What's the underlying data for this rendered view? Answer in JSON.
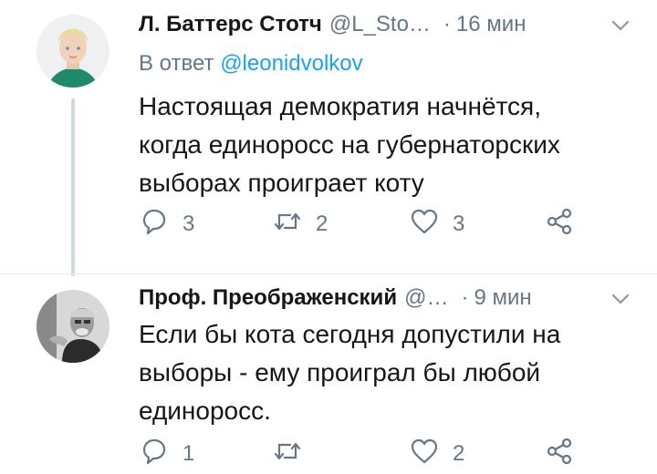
{
  "tweets": [
    {
      "author_name": "Л. Баттерс Стотч",
      "handle": "@L_Sto…",
      "dot": "·",
      "time": "16 мин",
      "reply_prefix": "В ответ",
      "reply_mention": "@leonidvolkov",
      "text_lines": [
        "Настоящая демократия начнётся,",
        "когда единоросс на губернаторских",
        "выборах проиграет коту"
      ],
      "counts": {
        "replies": "3",
        "retweets": "2",
        "likes": "3"
      }
    },
    {
      "author_name": "Проф. Преображенский",
      "handle": "@…",
      "dot": "·",
      "time": "9 мин",
      "text_lines": [
        "Если бы кота сегодня допустили на",
        "выборы - ему проиграл бы любой",
        "единоросс."
      ],
      "counts": {
        "replies": "1",
        "retweets": "",
        "likes": "2"
      }
    }
  ],
  "colors": {
    "text": "#14171a",
    "secondary": "#657786",
    "link": "#1da1f2",
    "line": "#cfd9de"
  },
  "icons": [
    "reply-icon",
    "retweet-icon",
    "like-icon",
    "share-icon",
    "chevron-down-icon"
  ]
}
